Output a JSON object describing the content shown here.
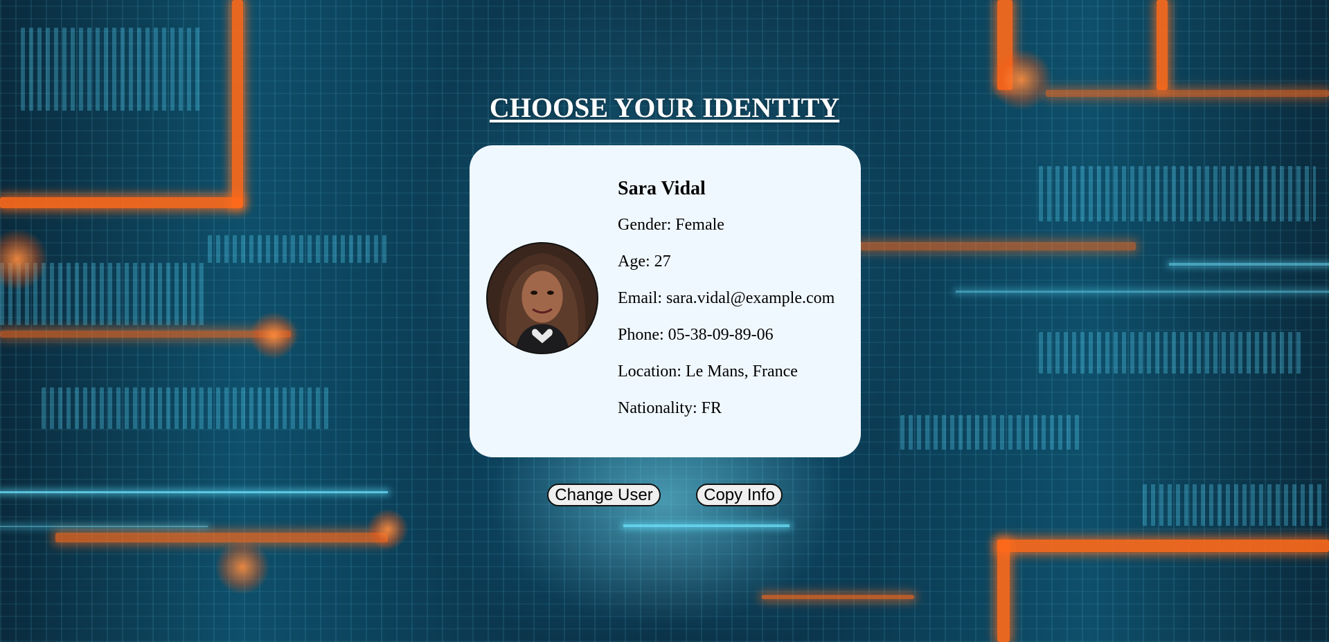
{
  "page": {
    "title": "CHOOSE YOUR IDENTITY"
  },
  "profile": {
    "name": "Sara Vidal",
    "gender": "Gender: Female",
    "age": "Age: 27",
    "email": "Email: sara.vidal@example.com",
    "phone": "Phone: 05-38-09-89-06",
    "location": "Location: Le Mans, France",
    "nationality": "Nationality: FR",
    "avatar_icon": "user-photo"
  },
  "actions": {
    "change_user_label": "Change User",
    "copy_info_label": "Copy Info"
  },
  "colors": {
    "card_background": "#f0f8ff",
    "title_color": "#ffffff",
    "button_background": "#efefef",
    "accent_orange": "#ff6a1a",
    "accent_cyan": "#6fe4ff"
  }
}
